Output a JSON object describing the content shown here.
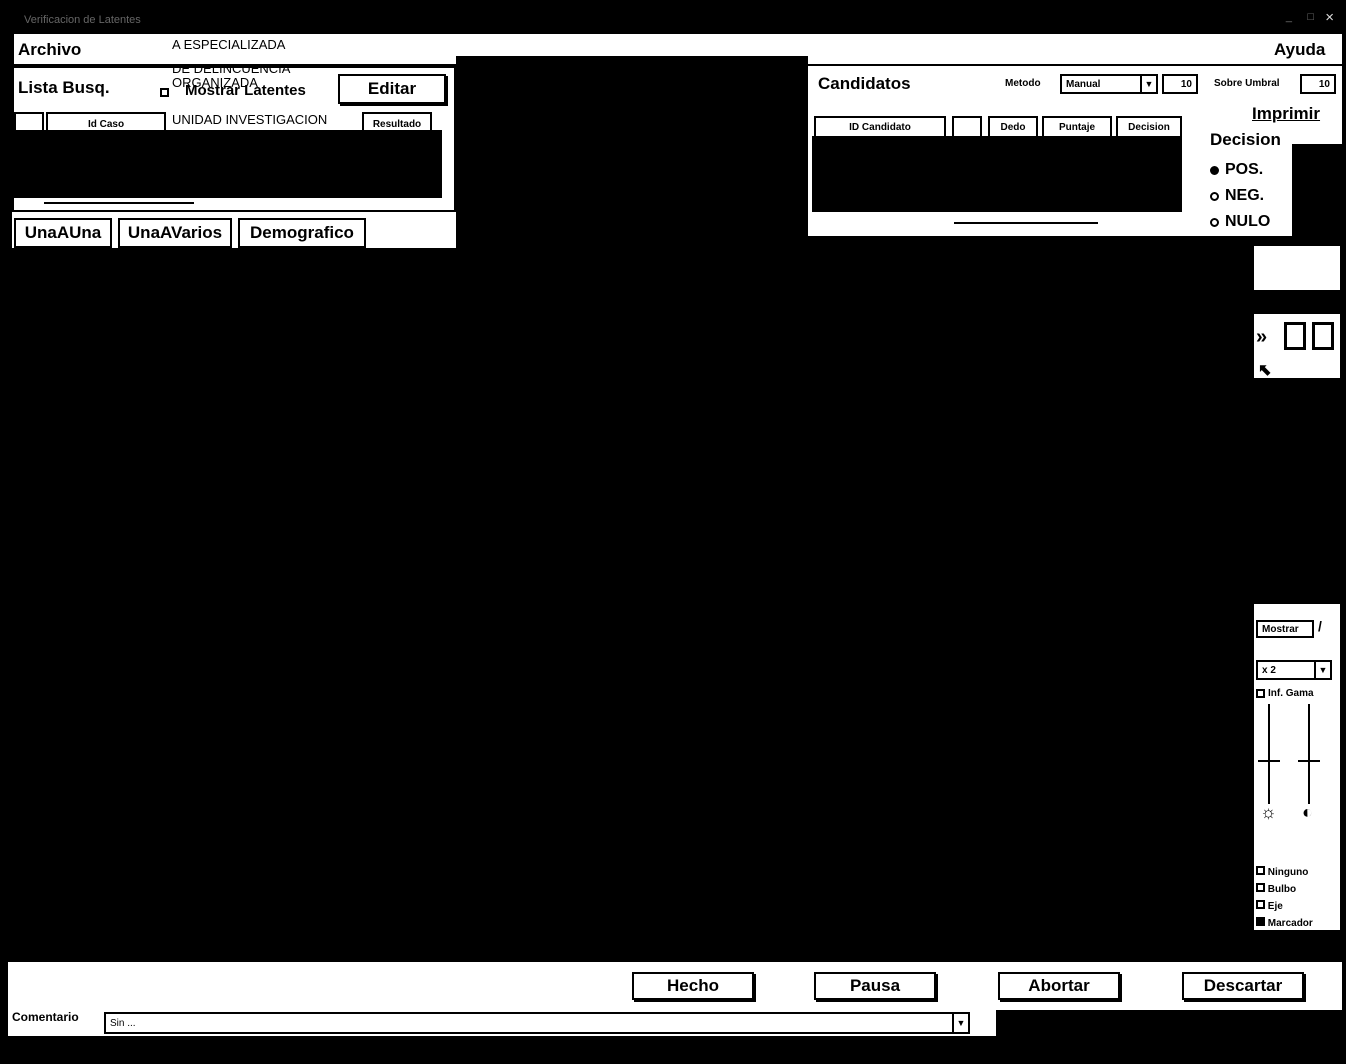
{
  "window": {
    "title": "Verificacion de Latentes",
    "controls": {
      "minimize": "_",
      "maximize": "□",
      "close": "×"
    }
  },
  "menu": {
    "file": "Archivo",
    "help": "Ayuda",
    "case_header_lines": [
      "A ESPECIALIZADA",
      "DE DELINCUENCIA",
      "ORGANIZADA",
      "UNIDAD INVESTIGACION"
    ]
  },
  "left_panel": {
    "search_list_label": "Lista Busq.",
    "show_latents_label": "Mostrar Latentes",
    "show_latents_checked": false,
    "edit_button": "Editar",
    "columns": [
      "Id Caso",
      "Resultado"
    ]
  },
  "tabs": [
    "UnaAUna",
    "UnaAVarios",
    "Demografico"
  ],
  "candidates_panel": {
    "title": "Candidatos",
    "method_label": "Metodo",
    "method_value": "Manual",
    "count_value": "10",
    "threshold_label": "Sobre Umbral",
    "threshold_value": "10",
    "print_button": "Imprimir",
    "columns": [
      "ID Candidato",
      "Dedo",
      "Puntaje",
      "Decision"
    ]
  },
  "decision": {
    "label": "Decision",
    "options": [
      {
        "label": "POS.",
        "selected": true
      },
      {
        "label": "NEG.",
        "selected": false
      },
      {
        "label": "NULO",
        "selected": false
      }
    ]
  },
  "right_toolbar": {
    "invert_label": "Inf. Gama",
    "invert_checked": true,
    "zoom_value": "x 2",
    "show_label": "Mostrar",
    "overlay_options": [
      {
        "label": "Ninguno",
        "checked": false
      },
      {
        "label": "Bulbo",
        "checked": false
      },
      {
        "label": "Eje",
        "checked": false
      },
      {
        "label": "Marcador",
        "checked": true
      }
    ]
  },
  "bottom_buttons": {
    "done": "Hecho",
    "pause": "Pausa",
    "abort": "Abortar",
    "discard": "Descartar"
  },
  "comments": {
    "label": "Comentario",
    "value": "Sin ..."
  }
}
